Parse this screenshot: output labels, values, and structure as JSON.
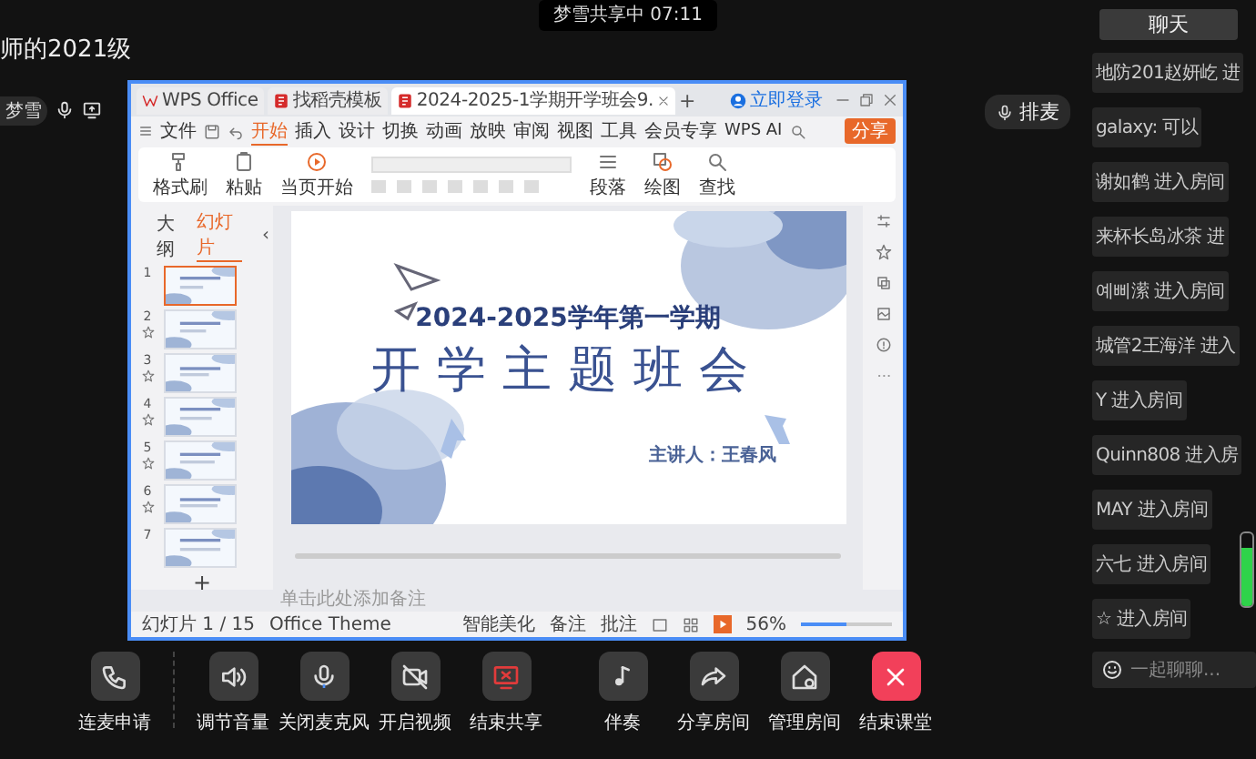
{
  "toast": {
    "text": "梦雪共享中 07:11"
  },
  "room_title": "师的2021级",
  "presenter": {
    "name": "梦雪"
  },
  "queue_button": "排麦",
  "share_window": {
    "tabs": [
      {
        "label": "WPS Office",
        "kind": "home",
        "selected": false
      },
      {
        "label": "找稻壳模板",
        "kind": "template",
        "selected": false
      },
      {
        "label": "2024-2025-1学期开学班会9.",
        "kind": "doc",
        "selected": true
      }
    ],
    "new_tab": "+",
    "login": "立即登录",
    "file_menu": "文件",
    "menu": [
      {
        "label": "开始",
        "selected": true
      },
      {
        "label": "插入",
        "selected": false
      },
      {
        "label": "设计",
        "selected": false
      },
      {
        "label": "切换",
        "selected": false
      },
      {
        "label": "动画",
        "selected": false
      },
      {
        "label": "放映",
        "selected": false
      },
      {
        "label": "审阅",
        "selected": false
      },
      {
        "label": "视图",
        "selected": false
      },
      {
        "label": "工具",
        "selected": false
      },
      {
        "label": "会员专享",
        "selected": false
      }
    ],
    "ai": "WPS AI",
    "share": "分享",
    "ribbon": [
      {
        "label": "格式刷"
      },
      {
        "label": "粘贴"
      },
      {
        "label": "当页开始"
      },
      {
        "label": "段落"
      },
      {
        "label": "绘图"
      },
      {
        "label": "查找"
      }
    ],
    "collapse": "‹",
    "panel_tabs": [
      {
        "label": "大纲",
        "selected": false
      },
      {
        "label": "幻灯片",
        "selected": true
      }
    ],
    "thumbnails": [
      {
        "number": "1",
        "selected": true,
        "animated": false
      },
      {
        "number": "2",
        "selected": false,
        "animated": true
      },
      {
        "number": "3",
        "selected": false,
        "animated": true
      },
      {
        "number": "4",
        "selected": false,
        "animated": true
      },
      {
        "number": "5",
        "selected": false,
        "animated": true
      },
      {
        "number": "6",
        "selected": false,
        "animated": true
      },
      {
        "number": "7",
        "selected": false,
        "animated": false
      }
    ],
    "add_slide": "+",
    "slide": {
      "subtitle": "2024-2025学年第一学期",
      "title": "开学主题班会",
      "speaker": "主讲人：王春风"
    },
    "notes_placeholder": "单击此处添加备注",
    "status": {
      "slide_counter": "幻灯片 1 / 15",
      "theme": "Office Theme",
      "beautify": "智能美化",
      "notes": "备注",
      "comments": "批注",
      "zoom": "56%",
      "zoom_slider": {
        "level": 0.5
      }
    }
  },
  "chat": {
    "title": "聊天",
    "messages": [
      {
        "text": "地防201赵妍屹 进"
      },
      {
        "text": "galaxy: 可以"
      },
      {
        "text": "谢如鹤 进入房间"
      },
      {
        "text": "来杯长岛冰茶 进"
      },
      {
        "text": "예삐潆 进入房间"
      },
      {
        "text": "城管2王海洋 进入"
      },
      {
        "text": "Y 进入房间"
      },
      {
        "text": "Quinn808 进入房"
      },
      {
        "text": "MAY 进入房间"
      },
      {
        "text": "六七 进入房间"
      },
      {
        "text": "☆ 进入房间"
      }
    ],
    "input": {
      "placeholder": "一起聊聊..."
    },
    "mic_meter": {
      "level": 0.8
    }
  },
  "toolbar": [
    {
      "label": "连麦申请",
      "kind": "normal"
    },
    {
      "label": "调节音量",
      "kind": "normal"
    },
    {
      "label": "关闭麦克风",
      "kind": "normal"
    },
    {
      "label": "开启视频",
      "kind": "normal"
    },
    {
      "label": "结束共享",
      "kind": "alert"
    },
    {
      "label": "伴奏",
      "kind": "normal"
    },
    {
      "label": "分享房间",
      "kind": "normal"
    },
    {
      "label": "管理房间",
      "kind": "normal"
    },
    {
      "label": "结束课堂",
      "kind": "danger"
    }
  ]
}
